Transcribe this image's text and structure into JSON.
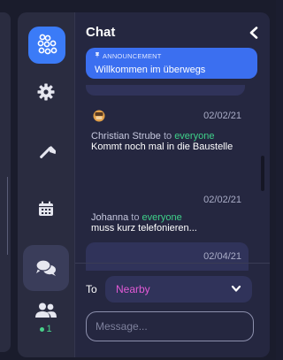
{
  "chat": {
    "title": "Chat",
    "announcement": {
      "label": "ANNOUNCEMENT",
      "text": "Willkommen im überwegs"
    },
    "messages": [
      {
        "timestamp": "02/02/21",
        "sender": "Christian Strube",
        "to_word": "to",
        "recipient": "everyone",
        "text": "Kommt noch mal in die Baustelle",
        "has_avatar": true
      },
      {
        "timestamp": "02/02/21",
        "sender": "Johanna",
        "to_word": "to",
        "recipient": "everyone",
        "text": "muss kurz telefonieren..."
      },
      {
        "timestamp": "02/04/21"
      }
    ],
    "composer": {
      "to_label": "To",
      "selected_audience": "Nearby",
      "placeholder": "Message..."
    }
  },
  "sidebar": {
    "online_count": "1"
  },
  "colors": {
    "accent_blue": "#3b7bf7",
    "recipient_green": "#3fd18a",
    "audience_pink": "#e25ad6",
    "online_green": "#48d18a"
  },
  "icons": [
    "logo-icon",
    "gear-icon",
    "hammer-icon",
    "calendar-icon",
    "chat-bubbles-icon",
    "users-icon",
    "chevron-left-icon",
    "pin-icon",
    "chevron-down-icon"
  ]
}
